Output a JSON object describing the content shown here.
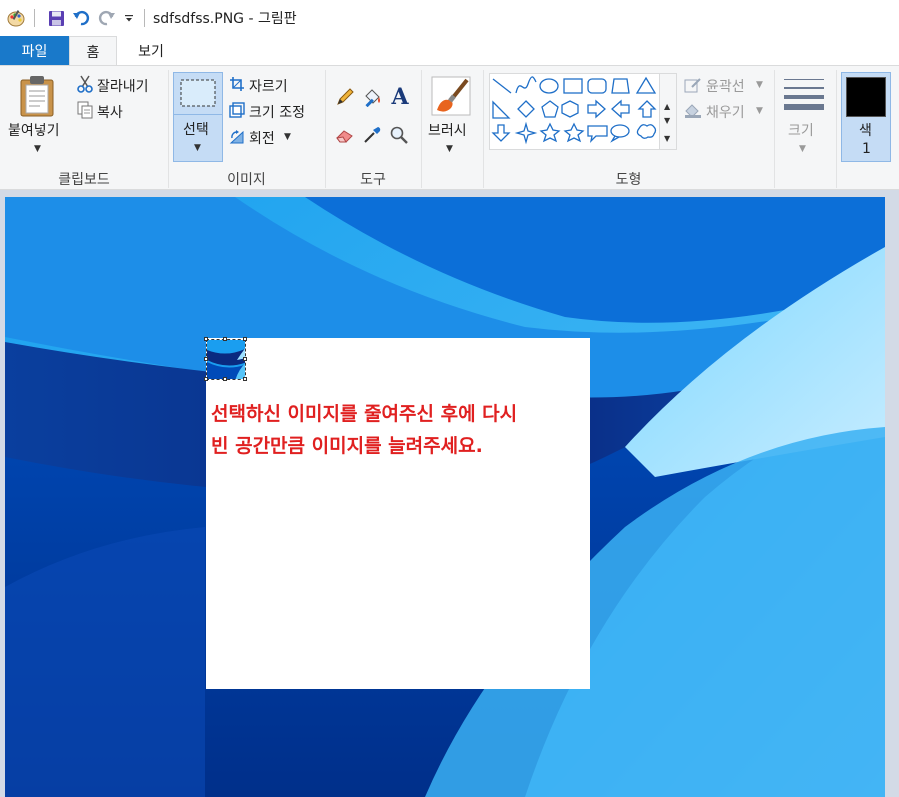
{
  "titlebar": {
    "title": "sdfsdfss.PNG - 그림판"
  },
  "tabs": {
    "file": "파일",
    "home": "홈",
    "view": "보기"
  },
  "clipboard": {
    "paste": "붙여넣기",
    "cut": "잘라내기",
    "copy": "복사",
    "group": "클립보드"
  },
  "image": {
    "select": "선택",
    "crop": "자르기",
    "resize": "크기 조정",
    "rotate": "회전",
    "group": "이미지"
  },
  "tools": {
    "group": "도구"
  },
  "brushes": {
    "label": "브러시"
  },
  "shapes": {
    "outline": "윤곽선",
    "fill": "채우기",
    "group": "도형"
  },
  "size": {
    "label": "크기"
  },
  "color": {
    "label": "색",
    "number": "1",
    "value": "#000000"
  },
  "canvas": {
    "message_line1": "선택하신 이미지를 줄여주신 후에 다시",
    "message_line2": "빈 공간만큼 이미지를 늘려주세요.",
    "message_color": "#e02020"
  }
}
